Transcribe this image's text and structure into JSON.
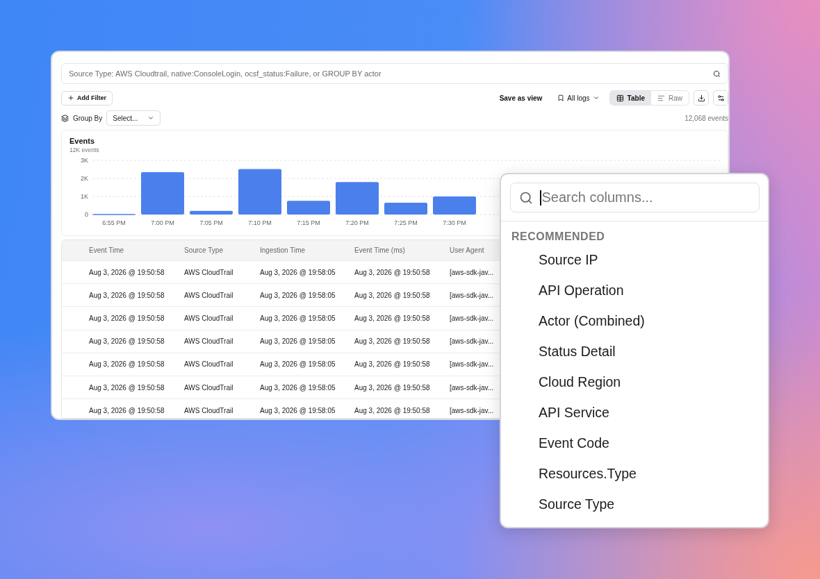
{
  "search": {
    "placeholder": "Source Type: AWS Cloudtrail, native:ConsoleLogin, ocsf_status:Failure, or GROUP BY actor"
  },
  "toolbar": {
    "add_filter": "Add Filter",
    "save_view": "Save as view",
    "saved_views": "All logs",
    "view_modes": [
      {
        "kind": "table",
        "label": "Table",
        "selected": true
      },
      {
        "kind": "raw",
        "label": "Raw",
        "selected": false
      }
    ]
  },
  "group_by": {
    "label": "Group By",
    "value": "Select..."
  },
  "event_count": "12,068 events",
  "events_panel": {
    "subtitle": "12K events",
    "chart_data": {
      "type": "bar",
      "title": "Events",
      "categories": [
        "6:55 PM",
        "7:00 PM",
        "7:05 PM",
        "7:10 PM",
        "7:15 PM",
        "7:20 PM",
        "7:25 PM",
        "7:30 PM"
      ],
      "values": [
        30,
        2350,
        200,
        2520,
        760,
        1800,
        650,
        1000
      ],
      "ylim": [
        0,
        3000
      ],
      "yticks": [
        {
          "value": 0,
          "label": "0"
        },
        {
          "value": 1000,
          "label": "1K"
        },
        {
          "value": 2000,
          "label": "2K"
        },
        {
          "value": 3000,
          "label": "3K"
        }
      ]
    }
  },
  "table": {
    "columns": [
      "Event Time",
      "Source Type",
      "Ingestion Time",
      "Event Time (ms)",
      "User Agent"
    ],
    "rows": [
      [
        "Aug 3, 2026 @ 19:50:58",
        "AWS CloudTrail",
        "Aug 3, 2026 @ 19:58:05",
        "Aug 3, 2026 @ 19:50:58",
        "[aws-sdk-jav..."
      ],
      [
        "Aug 3, 2026 @ 19:50:58",
        "AWS CloudTrail",
        "Aug 3, 2026 @ 19:58:05",
        "Aug 3, 2026 @ 19:50:58",
        "[aws-sdk-jav..."
      ],
      [
        "Aug 3, 2026 @ 19:50:58",
        "AWS CloudTrail",
        "Aug 3, 2026 @ 19:58:05",
        "Aug 3, 2026 @ 19:50:58",
        "[aws-sdk-jav..."
      ],
      [
        "Aug 3, 2026 @ 19:50:58",
        "AWS CloudTrail",
        "Aug 3, 2026 @ 19:58:05",
        "Aug 3, 2026 @ 19:50:58",
        "[aws-sdk-jav..."
      ],
      [
        "Aug 3, 2026 @ 19:50:58",
        "AWS CloudTrail",
        "Aug 3, 2026 @ 19:58:05",
        "Aug 3, 2026 @ 19:50:58",
        "[aws-sdk-jav..."
      ],
      [
        "Aug 3, 2026 @ 19:50:58",
        "AWS CloudTrail",
        "Aug 3, 2026 @ 19:58:05",
        "Aug 3, 2026 @ 19:50:58",
        "[aws-sdk-jav..."
      ],
      [
        "Aug 3, 2026 @ 19:50:58",
        "AWS CloudTrail",
        "Aug 3, 2026 @ 19:58:05",
        "Aug 3, 2026 @ 19:50:58",
        "[aws-sdk-jav..."
      ]
    ]
  },
  "column_picker": {
    "search": {
      "placeholder": "Search columns..."
    },
    "section": "RECOMMENDED",
    "items": [
      "Source IP",
      "API Operation",
      "Actor (Combined)",
      "Status Detail",
      "Cloud Region",
      "API Service",
      "Event Code",
      "Resources.Type",
      "Source Type"
    ]
  }
}
